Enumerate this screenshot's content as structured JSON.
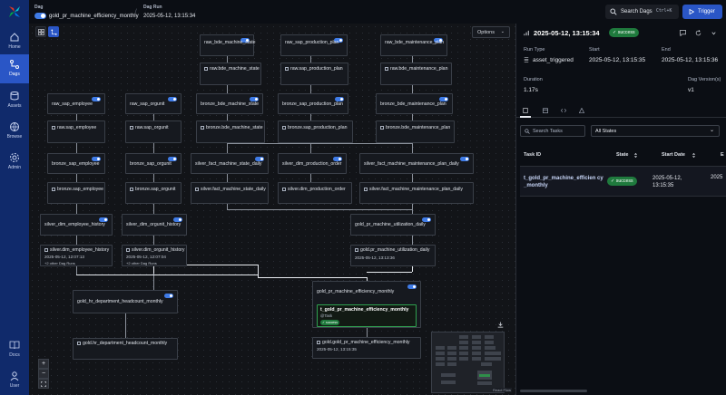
{
  "sidebar": {
    "items": [
      {
        "label": "Home",
        "icon": "home-icon"
      },
      {
        "label": "Dags",
        "icon": "dags-icon"
      },
      {
        "label": "Assets",
        "icon": "assets-icon"
      },
      {
        "label": "Browse",
        "icon": "browse-icon"
      },
      {
        "label": "Admin",
        "icon": "admin-icon"
      },
      {
        "label": "Docs",
        "icon": "docs-icon"
      },
      {
        "label": "User",
        "icon": "user-icon"
      }
    ]
  },
  "topbar": {
    "dag_label": "Dag",
    "dag_name": "gold_pr_machine_efficiency_monthly",
    "run_label": "Dag Run",
    "run_value": "2025-05-12, 13:15:34",
    "search_label": "Search Dags",
    "search_kbd": "Ctrl+K",
    "trigger_label": "Trigger"
  },
  "graph": {
    "options_label": "Options",
    "nodes": {
      "n1": {
        "name": "raw_bde_machine_state"
      },
      "n2": {
        "name": "raw_sap_production_plan"
      },
      "n3": {
        "name": "raw_bde_maintenance_plan"
      },
      "a1": {
        "name": "raw.bde_machine_state"
      },
      "a2": {
        "name": "raw.sap_production_plan"
      },
      "a3": {
        "name": "raw.bde_maintenance_plan"
      },
      "n4": {
        "name": "raw_sap_employee"
      },
      "n5": {
        "name": "raw_sap_orgunit"
      },
      "n6": {
        "name": "bronze_bde_machine_state"
      },
      "n7": {
        "name": "bronze_sap_production_plan"
      },
      "n8": {
        "name": "bronze_bde_maintenance_plan"
      },
      "a4": {
        "name": "raw.sap_employee"
      },
      "a5": {
        "name": "raw.sap_orgunit"
      },
      "a6": {
        "name": "bronze.bde_machine_state"
      },
      "a7": {
        "name": "bronze.sap_production_plan"
      },
      "a8": {
        "name": "bronze.bde_maintenance_plan"
      },
      "n9": {
        "name": "bronze_sap_employee"
      },
      "n10": {
        "name": "bronze_sap_orgunit"
      },
      "n11": {
        "name": "silver_fact_machine_state_daily"
      },
      "n12": {
        "name": "silver_dim_production_order"
      },
      "n13": {
        "name": "silver_fact_machine_maintenance_plan_daily"
      },
      "a9": {
        "name": "bronze.sap_employee"
      },
      "a10": {
        "name": "bronze.sap_orgunit"
      },
      "a11": {
        "name": "silver.fact_machine_state_daily"
      },
      "a12": {
        "name": "silver.dim_production_order"
      },
      "a13": {
        "name": "silver.fact_machine_maintenance_plan_daily"
      },
      "n14": {
        "name": "silver_dim_employee_history"
      },
      "n15": {
        "name": "silver_dim_orgunit_history"
      },
      "n16": {
        "name": "gold_pr_machine_utilization_daily"
      },
      "a14": {
        "name": "silver.dim_employee_history",
        "date": "2025-05-12, 12:07:13",
        "more": "+2 other Dag Runs"
      },
      "a15": {
        "name": "silver.dim_orgunit_history",
        "date": "2025-05-12, 12:07:04",
        "more": "+2 other Dag Runs"
      },
      "a16": {
        "name": "gold.pr_machine_utilization_daily",
        "date": "2025-05-12, 13:13:36"
      },
      "n17": {
        "name": "gold_hr_department_headcount_monthly"
      },
      "n18": {
        "name": "gold_pr_machine_efficiency_monthly"
      },
      "t1": {
        "name": "t_gold_pr_machine_efficiency_monthly",
        "sub": "@Task",
        "status": "success"
      },
      "a17": {
        "name": "gold.hr_department_headcount_monthly"
      },
      "a18": {
        "name": "gold.gold_pr_machine_efficiency_monthly",
        "date": "2025-05-12, 13:15:35"
      }
    },
    "minimap_label": "React Flow"
  },
  "panel": {
    "title": "2025-05-12, 13:15:34",
    "status": "success",
    "run_type_label": "Run Type",
    "run_type": "asset_triggered",
    "start_label": "Start",
    "start": "2025-05-12, 13:15:35",
    "end_label": "End",
    "end": "2025-05-12, 13:15:36",
    "duration_label": "Duration",
    "duration": "1.17s",
    "version_label": "Dag Version(s)",
    "version": "v1",
    "search_placeholder": "Search Tasks",
    "states_label": "All States",
    "columns": {
      "task_id": "Task ID",
      "state": "State",
      "start_date": "Start Date",
      "end": "E"
    },
    "row": {
      "task_id": "t_gold_pr_machine_efficien cy_monthly",
      "state": "success",
      "start_date": "2025-05-12, 13:15:35",
      "end": "2025"
    }
  },
  "colors": {
    "accent": "#2a56c6",
    "success": "#1f7a3d",
    "sidebar": "#102a6b"
  }
}
